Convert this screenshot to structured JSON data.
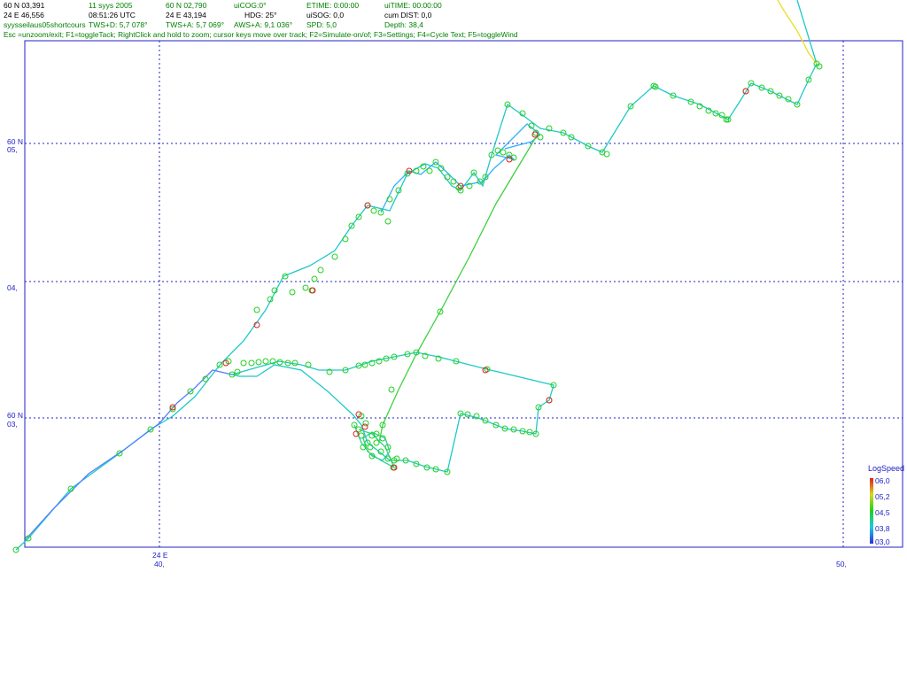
{
  "header": {
    "lat": "60 N 03,391",
    "lon": "24 E 46,556",
    "file": "syysseilaus05shortcours",
    "date": "11 syys 2005",
    "time": "08:51:26  UTC",
    "tws_d": "TWS+D: 5,7 078°",
    "cursor_lat": "60 N 02,790",
    "cursor_lon": "24 E 43,194",
    "tws_a": "TWS+A: 5,7 069°",
    "ui_cog": "uiCOG:0°",
    "hdg": "HDG: 25°",
    "aws_a": "AWS+A: 9,1 036°",
    "etime": "ETIME: 0:00:00",
    "ui_sog": "uiSOG: 0,0",
    "spd": "SPD: 5,0",
    "ui_time": "uiTIME: 00:00:00",
    "cum_dist": "cum DIST: 0,0",
    "depth": "Depth: 38,4",
    "help": "Esc =unzoom/exit; F1=toggleTack; RightClick and hold to zoom; cursor keys move over track; F2=Simulate-on/of; F3=Settings; F4=Cycle Text; F5=toggleWind"
  },
  "axes": {
    "lat_05_deg": "60 N",
    "lat_05_min": "05,",
    "lat_04_min": "04,",
    "lat_03_deg": "60 N",
    "lat_03_min": "03,",
    "lon_40_deg": "24 E",
    "lon_40_min": "40,",
    "lon_50_min": "50,"
  },
  "legend": {
    "title": "LogSpeed",
    "values": [
      "06,0",
      "05,2",
      "04,5",
      "03,8",
      "03,0"
    ],
    "colors": [
      "#e02020",
      "#d8d820",
      "#20d020",
      "#20c8e0",
      "#3030e0"
    ]
  },
  "colors": {
    "frame": "#2020c8",
    "grid": "#2020c8",
    "track_main": "#20c8c8",
    "marker": "#20d020",
    "marker_fast": "#e02020"
  }
}
